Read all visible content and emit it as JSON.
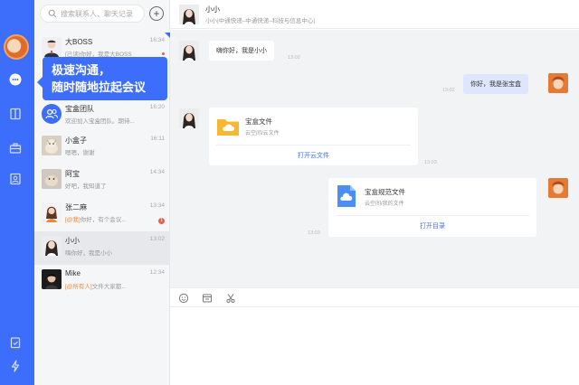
{
  "search": {
    "placeholder": "搜索联系人、聊天记录"
  },
  "add_icon": "+",
  "tooltip": {
    "line1": "极速沟通，",
    "line2": "随时随地拉起会议"
  },
  "conversations": [
    {
      "name": "大BOSS",
      "preview": "[已读]你好，我是大BOSS",
      "time": "16:34",
      "dot": ""
    },
    {
      "name": "宝盒团队",
      "preview": "欢迎加入宝盒团队。期待...",
      "time": "16:20",
      "dot": ""
    },
    {
      "name": "小盒子",
      "preview": "嗯嗯，谢谢",
      "time": "16:11",
      "dot": ""
    },
    {
      "name": "阿宝",
      "preview": "好吧，我知道了",
      "time": "14:34",
      "dot": ""
    },
    {
      "name": "张二麻",
      "tag": "[@我]",
      "preview": "你好，有个会议...",
      "time": "13:34",
      "dot": "1"
    },
    {
      "name": "小小",
      "preview": "嗨你好，我是小小",
      "time": "13:02",
      "dot": ""
    },
    {
      "name": "Mike",
      "tag": "[@所有人]",
      "preview": "文件大家都...",
      "time": "12:34",
      "dot": ""
    }
  ],
  "header": {
    "name": "小小",
    "subtitle": "小小|中通快递–中通快递–科技与信息中心|"
  },
  "messages": {
    "m1": {
      "text": "嗨你好，我是小小",
      "time": "13:02"
    },
    "m2": {
      "text": "你好，我是张宝盒",
      "time": "13:02"
    },
    "card1": {
      "title": "宝盒文件",
      "sub": "云空间/云文件",
      "action": "打开云文件",
      "time": "13:03"
    },
    "card2": {
      "title": "宝盒规范文件",
      "sub": "云空间/我的文件",
      "action": "打开目录",
      "time": "13:03"
    }
  },
  "colors": {
    "accent": "#3d6dfb",
    "sidebar": "#3d6dfb",
    "folder": "#f7b731",
    "doc": "#4a8ff7"
  }
}
